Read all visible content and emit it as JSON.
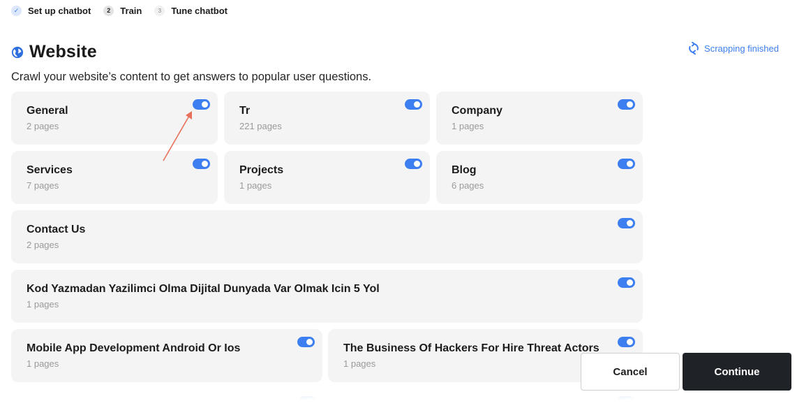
{
  "stepper": {
    "steps": [
      {
        "number": "✓",
        "label": "Set up chatbot",
        "state": "done"
      },
      {
        "number": "2",
        "label": "Train",
        "state": "active"
      },
      {
        "number": "3",
        "label": "Tune chatbot",
        "state": "todo"
      }
    ]
  },
  "header": {
    "icon": "globe-icon",
    "title": "Website",
    "subtitle": "Crawl your website’s content to get answers to popular user questions.",
    "status_icon": "refresh-icon",
    "status_text": "Scrapping finished"
  },
  "cards": [
    {
      "title": "General",
      "pages": "2 pages",
      "enabled": true
    },
    {
      "title": "Tr",
      "pages": "221 pages",
      "enabled": true
    },
    {
      "title": "Company",
      "pages": "1 pages",
      "enabled": true
    },
    {
      "title": "Services",
      "pages": "7 pages",
      "enabled": true
    },
    {
      "title": "Projects",
      "pages": "1 pages",
      "enabled": true
    },
    {
      "title": "Blog",
      "pages": "6 pages",
      "enabled": true
    },
    {
      "title": "Contact Us",
      "pages": "2 pages",
      "enabled": true
    },
    {
      "title": "Kod Yazmadan Yazilimci Olma Dijital Dunyada Var Olmak Icin 5 Yol",
      "pages": "1 pages",
      "enabled": true
    },
    {
      "title": "Mobile App Development Android Or Ios",
      "pages": "1 pages",
      "enabled": true
    },
    {
      "title": "The Business Of Hackers For Hire Threat Actors",
      "pages": "1 pages",
      "enabled": true
    }
  ],
  "footer": {
    "cancel_label": "Cancel",
    "continue_label": "Continue"
  },
  "colors": {
    "accent": "#3d7ff0",
    "card_bg": "#f4f4f4",
    "annotation_arrow": "#e8705a"
  }
}
